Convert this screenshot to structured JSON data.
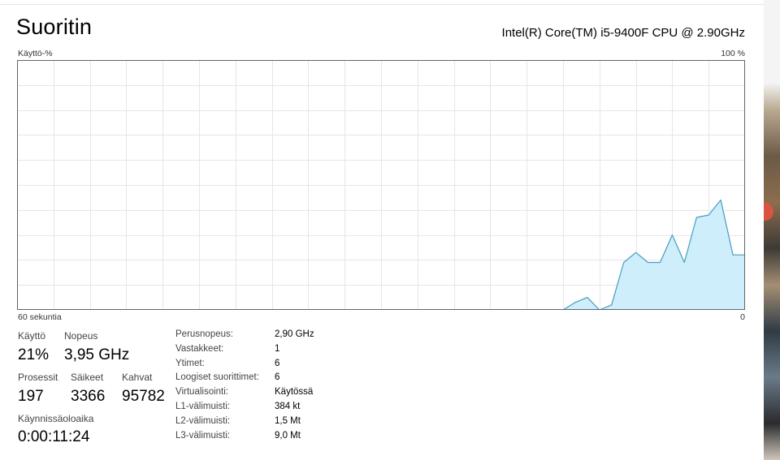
{
  "header": {
    "title": "Suoritin",
    "cpu_name": "Intel(R) Core(TM) i5-9400F CPU @ 2.90GHz"
  },
  "graph": {
    "y_label": "Käyttö-%",
    "y_max_label": "100 %",
    "x_left_label": "60 sekuntia",
    "x_right_label": "0",
    "line_color": "#4a9bbf",
    "fill_color": "#cdeefa",
    "grid_color": "#e6e6e6",
    "border_color": "#5b6770"
  },
  "chart_data": {
    "type": "area",
    "x_unit": "seconds ago",
    "x": [
      60,
      59,
      58,
      57,
      56,
      55,
      54,
      53,
      52,
      51,
      50,
      49,
      48,
      47,
      46,
      45,
      44,
      43,
      42,
      41,
      40,
      39,
      38,
      37,
      36,
      35,
      34,
      33,
      32,
      31,
      30,
      29,
      28,
      27,
      26,
      25,
      24,
      23,
      22,
      21,
      20,
      19,
      18,
      17,
      16,
      15,
      14,
      13,
      12,
      11,
      10,
      9,
      8,
      7,
      6,
      5,
      4,
      3,
      2,
      1,
      0
    ],
    "values": [
      0,
      0,
      0,
      0,
      0,
      0,
      0,
      0,
      0,
      0,
      0,
      0,
      0,
      0,
      0,
      0,
      0,
      0,
      0,
      0,
      0,
      0,
      0,
      0,
      0,
      0,
      0,
      0,
      0,
      0,
      0,
      0,
      0,
      0,
      0,
      0,
      0,
      0,
      0,
      0,
      0,
      0,
      0,
      0,
      0,
      0,
      3,
      5,
      0,
      2,
      19,
      23,
      19,
      19,
      30,
      19,
      37,
      38,
      44,
      22,
      22
    ],
    "ylim": [
      0,
      100
    ],
    "xlim": [
      60,
      0
    ],
    "grid": true
  },
  "stats": {
    "usage": {
      "label": "Käyttö",
      "value": "21%"
    },
    "speed": {
      "label": "Nopeus",
      "value": "3,95 GHz"
    },
    "processes": {
      "label": "Prosessit",
      "value": "197"
    },
    "threads": {
      "label": "Säikeet",
      "value": "3366"
    },
    "handles": {
      "label": "Kahvat",
      "value": "95782"
    },
    "uptime": {
      "label": "Käynnissäoloaika",
      "value": "0:00:11:24"
    }
  },
  "details": [
    {
      "key": "Perusnopeus:",
      "value": "2,90 GHz"
    },
    {
      "key": "Vastakkeet:",
      "value": "1"
    },
    {
      "key": "Ytimet:",
      "value": "6"
    },
    {
      "key": "Loogiset suorittimet:",
      "value": "6"
    },
    {
      "key": "Virtualisointi:",
      "value": "Käytössä"
    },
    {
      "key": "L1-välimuisti:",
      "value": "384 kt"
    },
    {
      "key": "L2-välimuisti:",
      "value": "1,5 Mt"
    },
    {
      "key": "L3-välimuisti:",
      "value": "9,0 Mt"
    }
  ]
}
